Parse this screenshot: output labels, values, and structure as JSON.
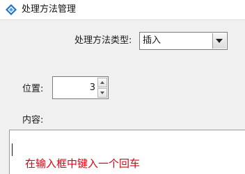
{
  "window": {
    "title": "处理方法管理",
    "icon": "app-diamond-icon"
  },
  "form": {
    "method_type": {
      "label": "处理方法类型:",
      "selected": "插入"
    },
    "position": {
      "label": "位置:",
      "value": "3"
    },
    "content": {
      "label": "内容:",
      "annotation": "在输入框中键入一个回车"
    }
  },
  "colors": {
    "annotation": "#e0000f",
    "icon_blue": "#1e73c8"
  }
}
